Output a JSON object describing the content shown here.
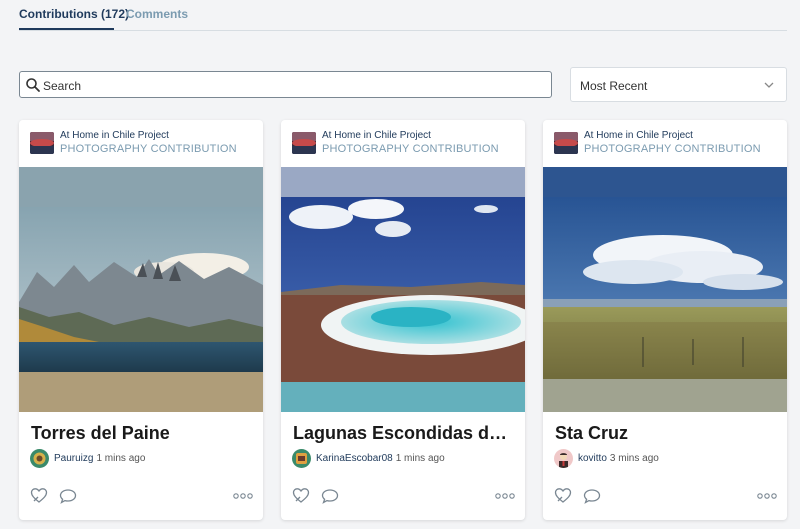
{
  "tabs": {
    "contributions_label": "Contributions (172)",
    "comments_label": "Comments"
  },
  "search": {
    "placeholder": "Search",
    "icon": "search-icon"
  },
  "sort": {
    "selected": "Most Recent",
    "icon": "chevron-down-icon"
  },
  "colors": {
    "accent": "#1f3a5c",
    "muted": "#7b9bb0",
    "link": "#223c5c",
    "card_bg": "#ffffff",
    "page_bg": "#f3f4f6"
  },
  "cards": [
    {
      "project": "At Home in Chile Project",
      "type": "PHOTOGRAPHY CONTRIBUTION",
      "title": "Torres del Paine",
      "author": "Pauruizg",
      "time": "1 mins ago"
    },
    {
      "project": "At Home in Chile Project",
      "type": "PHOTOGRAPHY CONTRIBUTION",
      "title": "Lagunas Escondidas de Baltinache",
      "author": "KarinaEscobar08",
      "time": "1 mins ago"
    },
    {
      "project": "At Home in Chile Project",
      "type": "PHOTOGRAPHY CONTRIBUTION",
      "title": "Sta Cruz",
      "author": "kovitto",
      "time": "3 mins ago"
    }
  ],
  "card_actions": {
    "like_icon": "heart-icon",
    "comment_icon": "comment-icon",
    "more_icon": "more-icon"
  }
}
